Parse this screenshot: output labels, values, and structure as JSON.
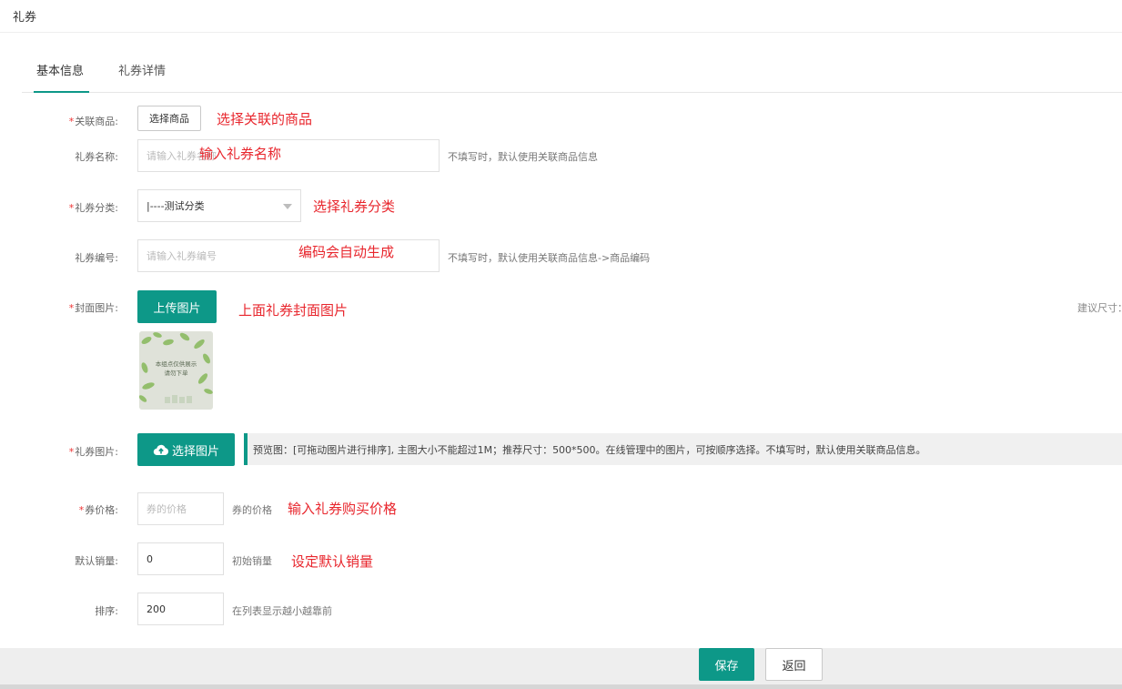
{
  "page": {
    "title": "礼券"
  },
  "tabs": [
    {
      "label": "基本信息",
      "active": true
    },
    {
      "label": "礼券详情",
      "active": false
    }
  ],
  "form": {
    "product": {
      "label": "关联商品:",
      "required": true,
      "button": "选择商品",
      "annotation": "选择关联的商品"
    },
    "name": {
      "label": "礼券名称:",
      "placeholder": "请输入礼券名称",
      "hint": "不填写时，默认使用关联商品信息",
      "annotation": "输入礼券名称"
    },
    "category": {
      "label": "礼券分类:",
      "required": true,
      "selected": "|----测试分类",
      "annotation": "选择礼券分类"
    },
    "code": {
      "label": "礼券编号:",
      "placeholder": "请输入礼券编号",
      "hint": "不填写时，默认使用关联商品信息->商品编码",
      "annotation": "编码会自动生成"
    },
    "cover": {
      "label": "封面图片:",
      "required": true,
      "button": "上传图片",
      "annotation": "上面礼券封面图片",
      "size_hint": "建议尺寸：",
      "thumb_text_line1": "本组点仅供展示",
      "thumb_text_line2": "请勿下单"
    },
    "images": {
      "label": "礼券图片:",
      "required": true,
      "button": "选择图片",
      "preview_text": "预览图：[可拖动图片进行排序], 主图大小不能超过1M；推荐尺寸：500*500。在线管理中的图片，可按顺序选择。不填写时，默认使用关联商品信息。"
    },
    "price": {
      "label": "券价格:",
      "required": true,
      "placeholder": "券的价格",
      "hint": "券的价格",
      "annotation": "输入礼券购买价格"
    },
    "sales": {
      "label": "默认销量:",
      "value": "0",
      "hint": "初始销量",
      "annotation": "设定默认销量"
    },
    "sort": {
      "label": "排序:",
      "value": "200",
      "hint": "在列表显示越小越靠前"
    }
  },
  "footer": {
    "save": "保存",
    "back": "返回"
  },
  "colors": {
    "accent": "#0d9888",
    "annotation": "#e8262d",
    "required": "#e33333"
  }
}
